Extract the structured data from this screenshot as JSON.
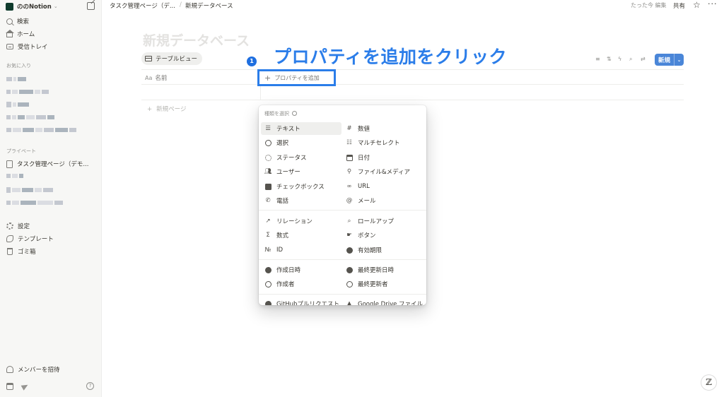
{
  "sidebar": {
    "workspace_name": "ののNotion",
    "nav": [
      {
        "label": "検索",
        "icon": "search-icon"
      },
      {
        "label": "ホーム",
        "icon": "home-icon"
      },
      {
        "label": "受信トレイ",
        "icon": "inbox-icon"
      }
    ],
    "favorites_label": "お気に入り",
    "private_label": "プライベート",
    "private_first_page": "タスク管理ページ（デモ...",
    "settings": [
      {
        "label": "設定",
        "icon": "gear-icon"
      },
      {
        "label": "テンプレート",
        "icon": "template-icon"
      },
      {
        "label": "ゴミ箱",
        "icon": "trash-icon"
      }
    ],
    "invite_label": "メンバーを招待",
    "help_label": "?"
  },
  "topbar": {
    "breadcrumb_parent": "タスク管理ページ（デ...",
    "breadcrumb_sep": "/",
    "breadcrumb_current": "新規データベース",
    "edited": "たった今 編集",
    "share": "共有",
    "star": "☆",
    "more": "···"
  },
  "main": {
    "title": "新規データベース",
    "view_tab": "テーブルビュー",
    "annotation_number": "1",
    "annotation_text": "プロパティを追加をクリック",
    "new_button": "新規",
    "new_button_dropdown": "⌄",
    "column_name_prefix": "Aa",
    "column_name": "名前",
    "add_property": "プロパティを追加",
    "new_page": "新規ページ",
    "toolbar": [
      "filter-icon",
      "sort-icon",
      "automation-icon",
      "search-icon",
      "settings-icon",
      "more-icon"
    ]
  },
  "menu": {
    "search_placeholder": "種類を選択",
    "left_items": [
      {
        "label": "テキスト",
        "icon": "text-icon"
      },
      {
        "label": "選択",
        "icon": "select-icon"
      },
      {
        "label": "ステータス",
        "icon": "status-icon"
      },
      {
        "label": "ユーザー",
        "icon": "person-icon"
      },
      {
        "label": "チェックボックス",
        "icon": "checkbox-icon"
      },
      {
        "label": "電話",
        "icon": "phone-icon"
      }
    ],
    "right_items": [
      {
        "label": "数値",
        "icon": "number-icon"
      },
      {
        "label": "マルチセレクト",
        "icon": "multi-select-icon"
      },
      {
        "label": "日付",
        "icon": "calendar-icon"
      },
      {
        "label": "ファイル&メディア",
        "icon": "attachment-icon"
      },
      {
        "label": "URL",
        "icon": "link-icon"
      },
      {
        "label": "メール",
        "icon": "at-icon"
      }
    ],
    "left_items2": [
      {
        "label": "リレーション",
        "icon": "relation-icon"
      },
      {
        "label": "数式",
        "icon": "formula-icon"
      },
      {
        "label": "ID",
        "icon": "id-icon"
      }
    ],
    "right_items2": [
      {
        "label": "ロールアップ",
        "icon": "rollup-icon"
      },
      {
        "label": "ボタン",
        "icon": "button-icon"
      },
      {
        "label": "有効期限",
        "icon": "verification-icon"
      }
    ],
    "left_items3": [
      {
        "label": "作成日時",
        "icon": "created-time-icon"
      },
      {
        "label": "作成者",
        "icon": "created-by-icon"
      }
    ],
    "right_items3": [
      {
        "label": "最終更新日時",
        "icon": "edited-time-icon"
      },
      {
        "label": "最終更新者",
        "icon": "edited-by-icon"
      }
    ],
    "left_items4": [
      {
        "label": "GitHubプルリクエスト",
        "icon": "github-icon"
      }
    ],
    "right_items4": [
      {
        "label": "Google Drive ファイル",
        "icon": "google-drive-icon"
      }
    ]
  },
  "corner_button": "ℤ",
  "colors": {
    "accent": "#2b7de9",
    "new_button": "#4a86d8",
    "sidebar_bg": "#f7f7f5"
  }
}
